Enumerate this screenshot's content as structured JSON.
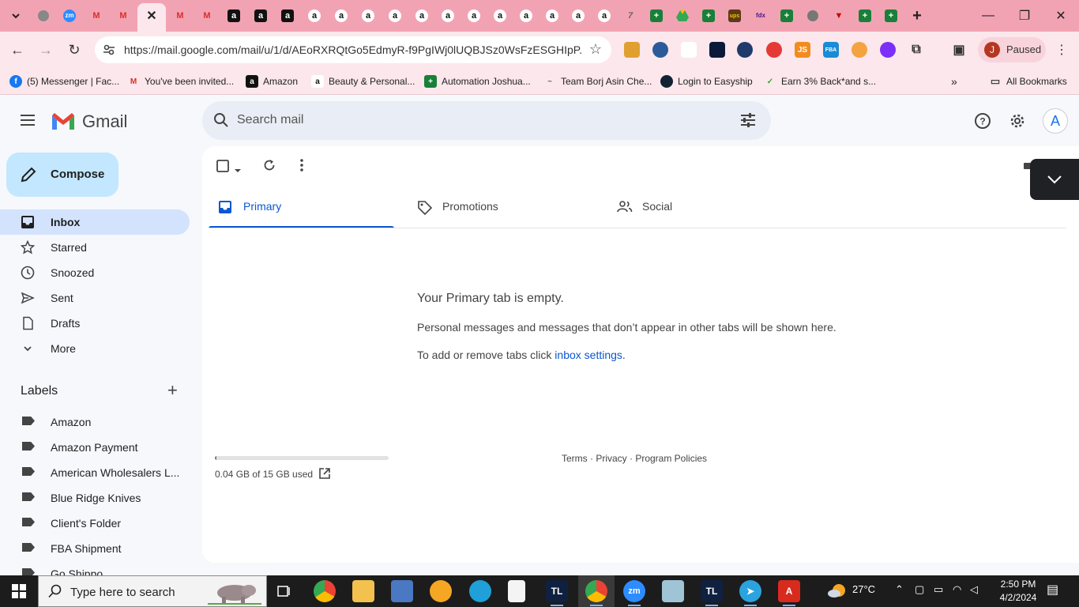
{
  "browser": {
    "url": "https://mail.google.com/mail/u/1/d/AEoRXRQtGo5EdmyR-f9PgIWj0lUQBJSz0WsFzESGHIpP...",
    "profile_initial": "J",
    "profile_status": "Paused",
    "bookmarks": [
      "(5) Messenger | Fac...",
      "You've been invited...",
      "Amazon",
      "Beauty & Personal...",
      "Automation Joshua...",
      "Team Borj Asin Che...",
      "Login to Easyship",
      "Earn 3% Back*and s..."
    ],
    "all_bookmarks": "All Bookmarks",
    "ext_js": "JS",
    "ext_fba": "FBA"
  },
  "gmail": {
    "logo": "Gmail",
    "search_placeholder": "Search mail",
    "account_initial": "A",
    "compose": "Compose",
    "nav": [
      "Inbox",
      "Starred",
      "Snoozed",
      "Sent",
      "Drafts",
      "More"
    ],
    "labels_title": "Labels",
    "labels": [
      "Amazon",
      "Amazon Payment",
      "American Wholesalers L...",
      "Blue Ridge Knives",
      "Client's Folder",
      "FBA Shipment",
      "Go Shippo"
    ],
    "tabs": [
      "Primary",
      "Promotions",
      "Social"
    ],
    "empty_title": "Your Primary tab is empty.",
    "empty_desc": "Personal messages and messages that don’t appear in other tabs will be shown here.",
    "empty_hint_prefix": "To add or remove tabs click ",
    "empty_hint_link": "inbox settings",
    "empty_hint_suffix": ".",
    "storage_used": "0.04 GB of 15 GB used",
    "storage_fraction": 0.003,
    "footer": "Terms · Privacy · Program Policies"
  },
  "taskbar": {
    "search_placeholder": "Type here to search",
    "temperature": "27°C",
    "time": "2:50 PM",
    "date": "4/2/2024"
  },
  "colors": {
    "tabstrip": "#f2a3b3",
    "toolbar": "#fbe7ec",
    "compose": "#c2e7ff",
    "nav_active": "#d3e3fd",
    "link": "#0b57d0"
  }
}
